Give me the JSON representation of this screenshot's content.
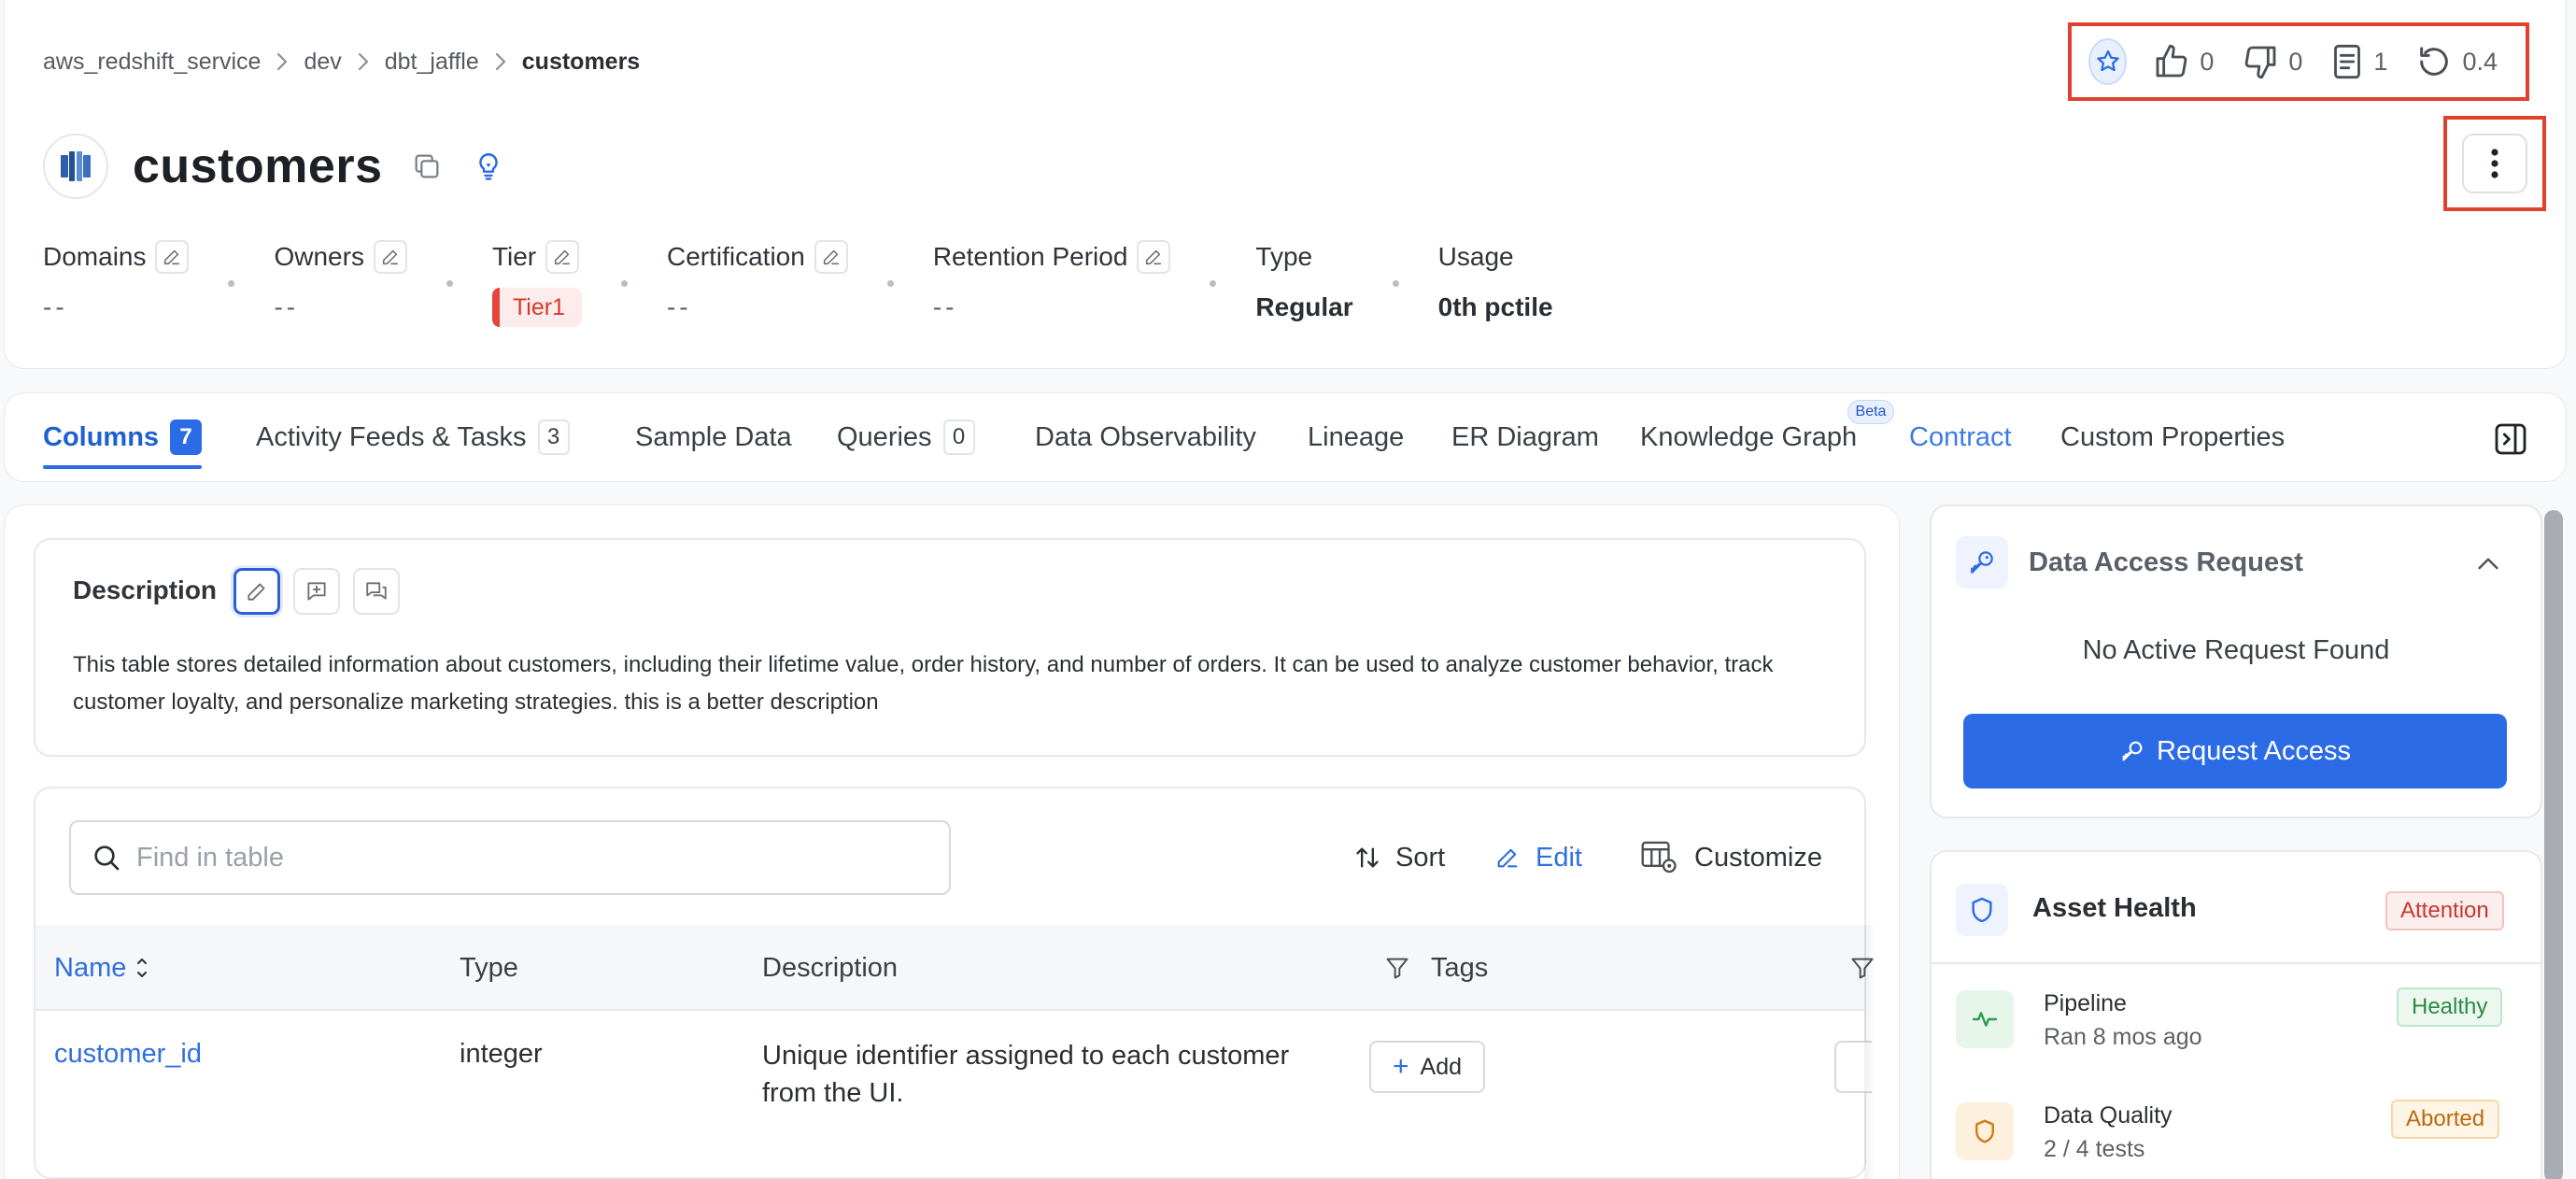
{
  "breadcrumb": [
    "aws_redshift_service",
    "dev",
    "dbt_jaffle",
    "customers"
  ],
  "entity": {
    "title": "customers"
  },
  "topbar": {
    "likes": "0",
    "dislikes": "0",
    "docs": "1",
    "version": "0.4"
  },
  "properties": {
    "domains": {
      "label": "Domains",
      "value": "--"
    },
    "owners": {
      "label": "Owners",
      "value": "--"
    },
    "tier": {
      "label": "Tier",
      "value": "Tier1"
    },
    "certification": {
      "label": "Certification",
      "value": "--"
    },
    "retention": {
      "label": "Retention Period",
      "value": "--"
    },
    "type": {
      "label": "Type",
      "value": "Regular"
    },
    "usage": {
      "label": "Usage",
      "value": "0th pctile"
    }
  },
  "tabs": [
    {
      "label": "Columns",
      "count": "7"
    },
    {
      "label": "Activity Feeds & Tasks",
      "count": "3"
    },
    {
      "label": "Sample Data"
    },
    {
      "label": "Queries",
      "count": "0"
    },
    {
      "label": "Data Observability"
    },
    {
      "label": "Lineage"
    },
    {
      "label": "ER Diagram"
    },
    {
      "label": "Knowledge Graph",
      "badge": "Beta"
    },
    {
      "label": "Contract"
    },
    {
      "label": "Custom Properties"
    }
  ],
  "description": {
    "title": "Description",
    "text": "This table stores detailed information about customers, including their lifetime value, order history, and number of orders. It can be used to analyze customer behavior, track customer loyalty, and personalize marketing strategies. this is a better description"
  },
  "table": {
    "search_placeholder": "Find in table",
    "actions": {
      "sort": "Sort",
      "edit": "Edit",
      "customize": "Customize"
    },
    "headers": [
      "Name",
      "Type",
      "Description",
      "Tags"
    ],
    "rows": [
      {
        "name": "customer_id",
        "type": "integer",
        "description": "Unique identifier assigned to each customer from the UI.",
        "tag_action": "Add"
      }
    ]
  },
  "access_request": {
    "title": "Data Access Request",
    "empty": "No Active Request Found",
    "button": "Request Access"
  },
  "asset_health": {
    "title": "Asset Health",
    "status": "Attention",
    "items": [
      {
        "title": "Pipeline",
        "subtitle": "Ran 8 mos ago",
        "status": "Healthy"
      },
      {
        "title": "Data Quality",
        "subtitle": "2 / 4 tests",
        "status": "Aborted"
      }
    ]
  },
  "colors": {
    "accent": "#2c6be6",
    "highlight_border": "#e0412f",
    "tier": "#d8372c"
  }
}
